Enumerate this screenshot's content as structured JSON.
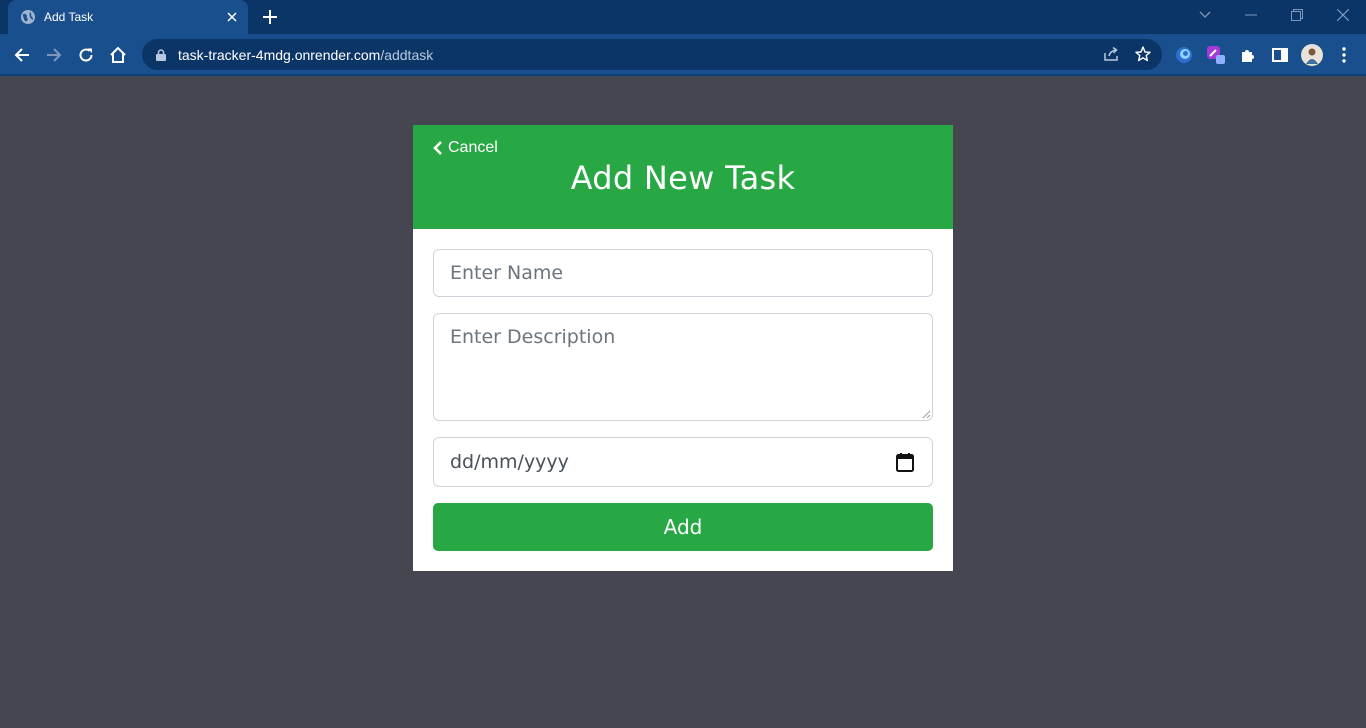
{
  "browser": {
    "tab_title": "Add Task",
    "url_host": "task-tracker-4mdg.onrender.com",
    "url_path": "/addtask"
  },
  "page": {
    "cancel_label": "Cancel",
    "title": "Add New Task",
    "name_placeholder": "Enter Name",
    "description_placeholder": "Enter Description",
    "date_placeholder": "dd/mm/yyyy",
    "add_label": "Add"
  },
  "colors": {
    "accent_green": "#28a745",
    "page_background": "#454650",
    "browser_frame": "#0b3566",
    "browser_toolbar": "#1a4f8d"
  }
}
